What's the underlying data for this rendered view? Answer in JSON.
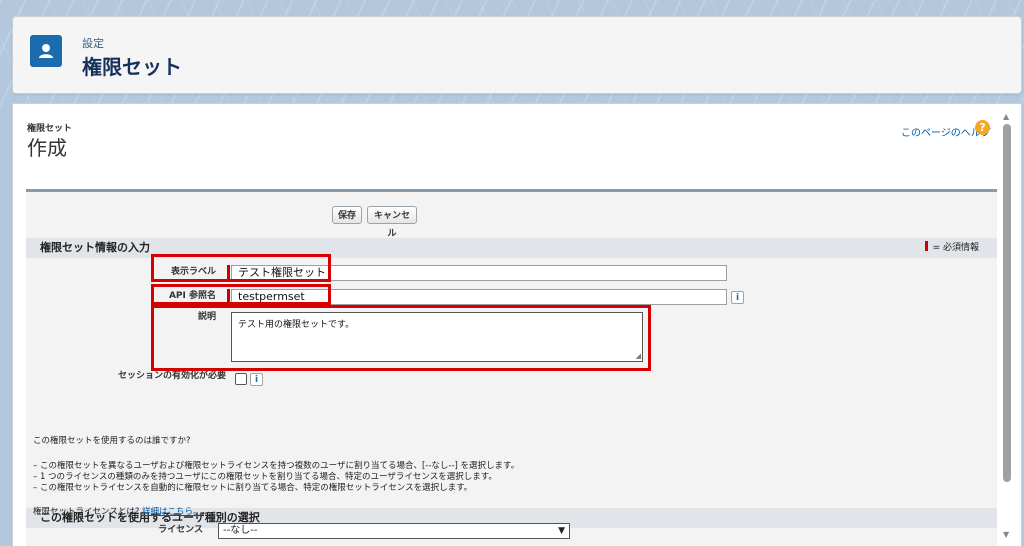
{
  "header": {
    "subtitle": "設定",
    "title": "権限セット",
    "icon": "user-icon"
  },
  "page": {
    "breadcrumb": "権限セット",
    "heading": "作成",
    "help_link": "このページのヘルプ",
    "help_icon": "?"
  },
  "toolbar": {
    "save_label": "保存",
    "cancel_label": "キャンセル"
  },
  "section_info": {
    "title": "権限セット情報の入力",
    "required_legend": "= 必須情報"
  },
  "fields": {
    "display_label": {
      "label": "表示ラベル",
      "value": "テスト権限セット"
    },
    "api_name": {
      "label": "API 参照名",
      "value": "testpermset"
    },
    "description": {
      "label": "説明",
      "value": "テスト用の権限セットです。"
    },
    "session_activation": {
      "label": "セッションの有効化が必要",
      "checked": false
    },
    "info_glyph": "i"
  },
  "section_license": {
    "title": "この権限セットを使用するユーザ種別の選択",
    "question": "この権限セットを使用するのは誰ですか?",
    "bullets": [
      "– この権限セットを異なるユーザおよび権限セットライセンスを持つ複数のユーザに割り当てる場合、[--なし--] を選択します。",
      "– 1 つのライセンスの種類のみを持つユーザにこの権限セットを割り当てる場合、特定のユーザライセンスを選択します。",
      "– この権限セットライセンスを自動的に権限セットに割り当てる場合、特定の権限セットライセンスを選択します。"
    ],
    "license_question": "権限セットライセンスとは?",
    "details_link": "詳細はこちら。",
    "license_label": "ライセンス",
    "license_value": "--なし--"
  },
  "colors": {
    "brand": "#1b6bb0",
    "highlight": "#d50000",
    "required": "#cc0000"
  }
}
